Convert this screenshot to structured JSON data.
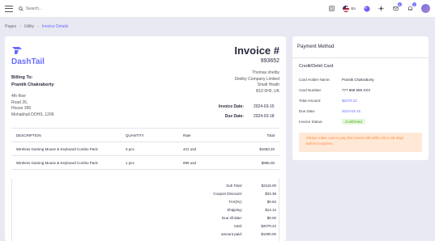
{
  "topbar": {
    "search_placeholder": "Search...",
    "language": "En",
    "notifications_count": "2",
    "messages_count": "6",
    "accent": "#696cff"
  },
  "breadcrumb": {
    "items": [
      "Pages",
      "Utility",
      "Invoice Details"
    ]
  },
  "invoice": {
    "brand": "DashTail",
    "title": "Invoice #",
    "number": "993652",
    "billing_to_label": "Billing To:",
    "customer_name": "Prantik Chakraborty",
    "customer_address": [
      "4th floor",
      "Road 26,",
      "House 395",
      "Mohakhali DOHS, 1206"
    ],
    "from_address": [
      "Thomas shelby",
      "Shelby Company Limited",
      "Small Heath",
      "B10 0HF, UK"
    ],
    "invoice_date_label": "Invoice Date:",
    "invoice_date": "2024-03-15",
    "due_date_label": "Due Date:",
    "due_date": "2024-03-18",
    "table": {
      "headers": [
        "DESCRIPTION",
        "QUANTITY",
        "Rate",
        "Total"
      ],
      "rows": [
        [
          "Wireless Gaming Mouse & Keyboard Combo Pack",
          "3 pcs",
          "421 usd",
          "$1683.20"
        ],
        [
          "Wireless Gaming Mouse & Keyboard Combo Pack",
          "1 pcs",
          "999 usd",
          "$996.00"
        ]
      ]
    },
    "summary": [
      {
        "label": "Sub Total:",
        "value": "$2116.00"
      },
      {
        "label": "Coupon Discount:",
        "value": "$34.36"
      },
      {
        "label": "TAX(%):",
        "value": "$0.82"
      },
      {
        "label": "Shipping:",
        "value": "$14.12"
      },
      {
        "label": "Due till date:",
        "value": "$0.00"
      },
      {
        "label": "total:",
        "value": "$2079.22"
      },
      {
        "label": "amount paid:",
        "value": "$1000.00"
      }
    ]
  },
  "payment": {
    "title": "Payment Method",
    "subtitle": "Credit/Debit Card",
    "rows": [
      {
        "label": "Card Holder Name:",
        "value": "Prantik Chakraborty"
      },
      {
        "label": "Card Number:",
        "value": "777 888 999 XXX"
      },
      {
        "label": "Total Amount:",
        "value": "$2079.22"
      },
      {
        "label": "Due Date:",
        "value": "2024-03-15"
      }
    ],
    "status_label": "Invoice Status:",
    "status_value": "Confirmed",
    "alert": "Please make sure to pay the invoice bill within 25 to 30 days before it expires."
  }
}
